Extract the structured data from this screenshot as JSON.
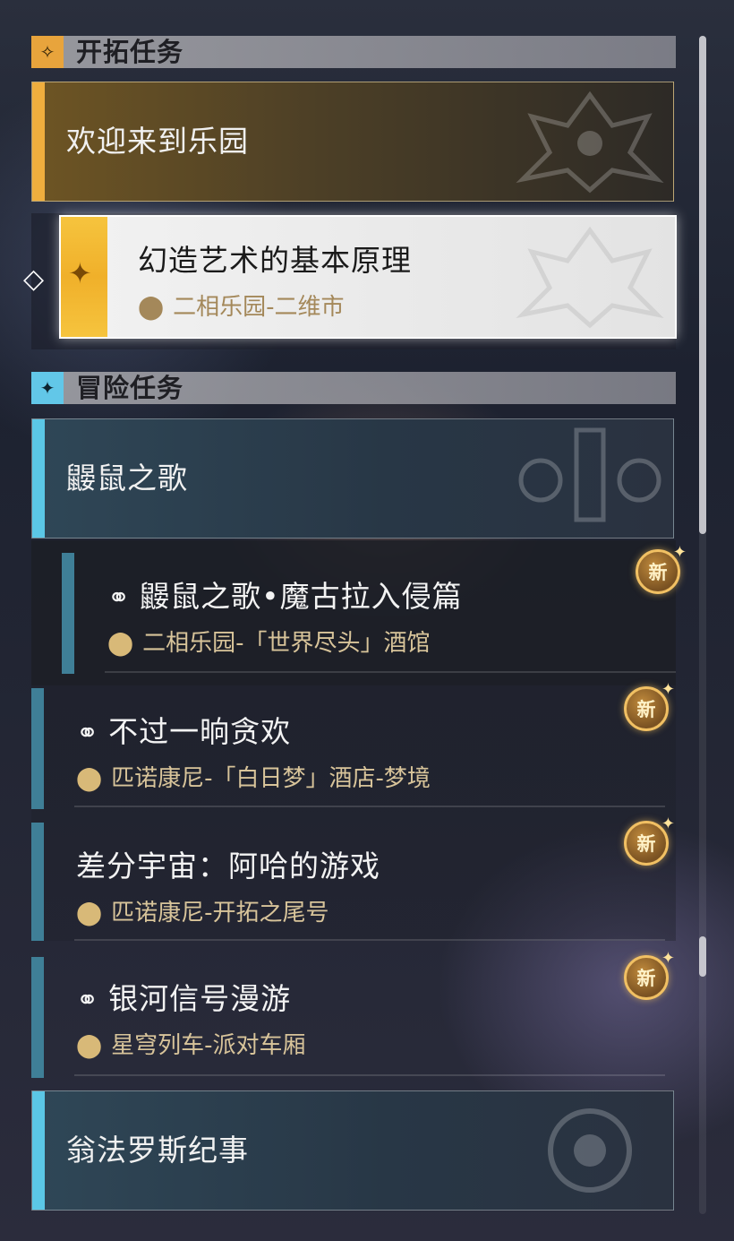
{
  "sections": {
    "pioneer": {
      "title": "开拓任务",
      "icon": "sparkle-compass-icon",
      "accent": "#efae3e"
    },
    "adventure": {
      "title": "冒险任务",
      "icon": "four-point-star-icon",
      "accent": "#5bc7e6"
    }
  },
  "pioneer_group": {
    "title": "欢迎来到乐园"
  },
  "selected_quest": {
    "title": "幻造艺术的基本原理",
    "location": "二相乐园-二维市"
  },
  "adventure_groups": [
    {
      "title": "鼹鼠之歌"
    },
    {
      "title": "翁法罗斯纪事"
    }
  ],
  "quests": [
    {
      "title": "鼹鼠之歌•魔古拉入侵篇",
      "location": "二相乐园-「世界尽头」酒馆",
      "badge": "新",
      "icon": "quest-link-icon"
    },
    {
      "title": "不过一晌贪欢",
      "location": "匹诺康尼-「白日梦」酒店-梦境",
      "badge": "新",
      "icon": "quest-link-icon"
    },
    {
      "title": "差分宇宙：阿哈的游戏",
      "location": "匹诺康尼-开拓之尾号",
      "badge": "新"
    },
    {
      "title": "银河信号漫游",
      "location": "星穹列车-派对车厢",
      "badge": "新",
      "icon": "quest-link-icon"
    }
  ]
}
